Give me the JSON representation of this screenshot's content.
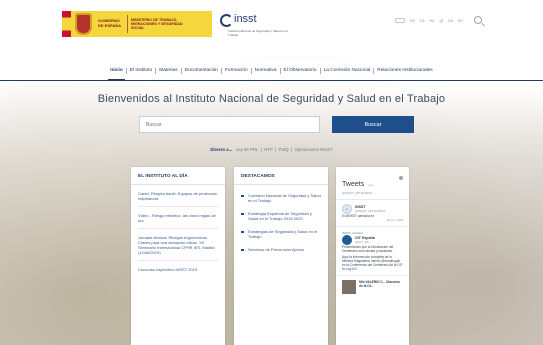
{
  "header": {
    "gov_text": "GOBIERNO DE ESPAÑA",
    "ministry_text": "MINISTERIO DE TRABAJO, MIGRACIONES Y SEGURIDAD SOCIAL",
    "insst_name": "insst",
    "insst_sub": "Instituto Nacional de Seguridad y Salud en el Trabajo",
    "utility_items": [
      "es",
      "ca",
      "eu",
      "gl",
      "va",
      "en"
    ]
  },
  "nav": {
    "items": [
      "Inicio",
      "El Instituto",
      "Materias",
      "Documentación",
      "Formación",
      "Normativa",
      "El Observatorio",
      "La Comisión Nacional",
      "Relaciones Institucionales"
    ],
    "active": "Inicio"
  },
  "main": {
    "welcome": "Bienvenidos al Instituto Nacional de Seguridad y Salud en el Trabajo",
    "search_placeholder": "Buscar",
    "search_button": "Buscar",
    "quick_label": "Directo a...",
    "quick_links": [
      "Ley de PRL",
      "NTP",
      "FISQ",
      "Operaciones INSST"
    ]
  },
  "instituto": {
    "title": "EL INSTITUTO AL DÍA",
    "items": [
      "Cartel. Respira tranki: Equipos de protección respiratoria",
      "Vídeo - Riesgo eléctrico: las cinco reglas de oro",
      "Jornada técnica: Riesgos ergonómicos. Claves para una actuación eficaz. XII Seminario Internacional CPHR IES. Madrid (12/06/2019)",
      "Concurso específico INSST 2019"
    ]
  },
  "destacamos": {
    "title": "DESTACAMOS",
    "items": [
      "Comisión Nacional de Seguridad y Salud en el Trabajo",
      "Estrategia Española de Seguridad y Salud en el Trabajo 2015-2020",
      "Estrategias de Seguridad y Salud en el Trabajo",
      "Servicios de Prevención Ajenos"
    ]
  },
  "twitter": {
    "title": "Tweets",
    "by": "por",
    "handle": "@INSST_MITRAMISS",
    "tweet1_name": "INSST",
    "tweet1_handle": "@INSST_MITRAMISS",
    "tweet1_text": "El #INSST participa en",
    "tweet1_date": "18 jun. 2019",
    "retweet_label": "INSST retwitteó",
    "tweet2_name": "OIT España",
    "tweet2_handle": "@OIT_ES",
    "tweet2_text": "Presentamos que la Declaración del Centenario sea robusta y bacalana!",
    "tweet2_more": "Aquí la intervención completa de la Ministra Magdalena Valerio @empleogob en la Conferencia del Centenario de la OIT",
    "tweet2_link": "ilo.org/100",
    "media_text": "Min VALERIO C... Discurso de la OI..."
  }
}
